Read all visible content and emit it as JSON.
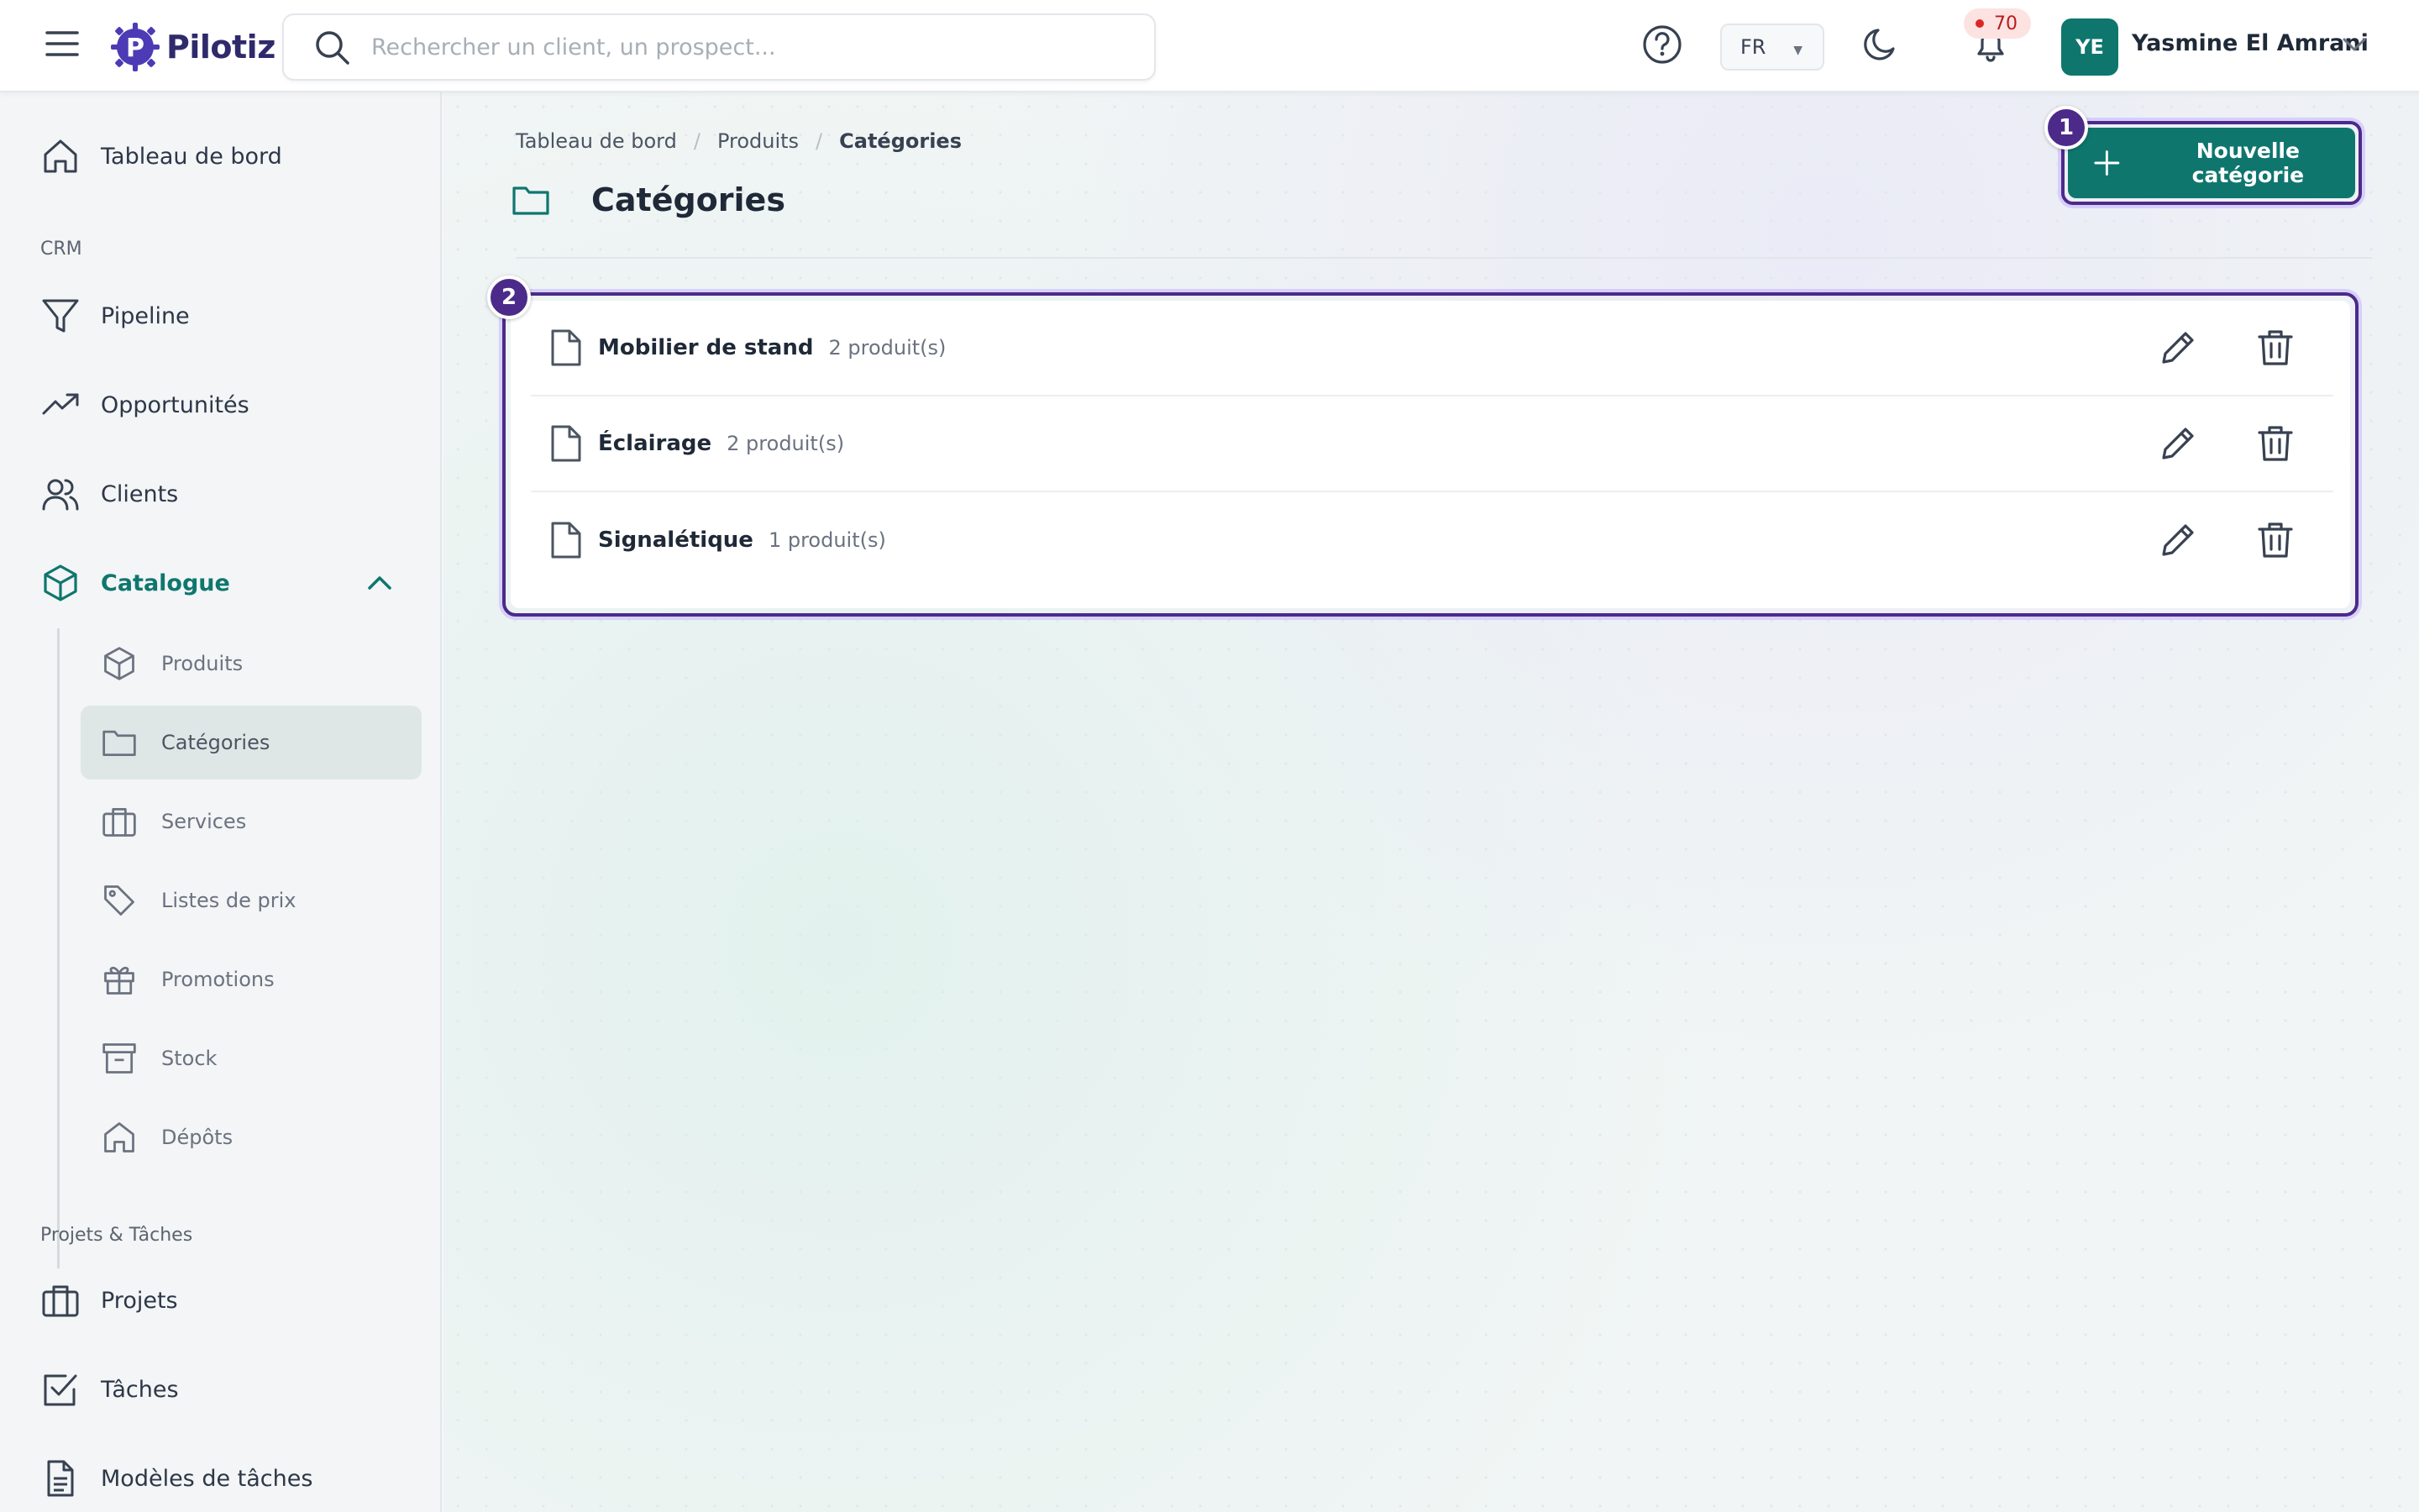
{
  "app": {
    "name": "Pilotiz"
  },
  "search": {
    "placeholder": "Rechercher un client, un prospect..."
  },
  "header": {
    "language": "FR",
    "notifications_count": "70",
    "user": {
      "initials": "YE",
      "name": "Yasmine El Amrani"
    },
    "colors": {
      "brand": "#0f766e",
      "badge_bg": "#fde2e2",
      "badge_text": "#b91c1c"
    }
  },
  "sidebar": {
    "items": [
      {
        "label": "Tableau de bord",
        "icon": "home-icon"
      }
    ],
    "sections": [
      {
        "label": "CRM",
        "items": [
          {
            "label": "Pipeline",
            "icon": "funnel-icon"
          },
          {
            "label": "Opportunités",
            "icon": "trending-up-icon"
          },
          {
            "label": "Clients",
            "icon": "users-icon"
          },
          {
            "label": "Catalogue",
            "icon": "cube-icon",
            "expanded": true,
            "active": true,
            "children": [
              {
                "label": "Produits",
                "icon": "cube-icon"
              },
              {
                "label": "Catégories",
                "icon": "folder-icon",
                "active": true
              },
              {
                "label": "Services",
                "icon": "briefcase-icon"
              },
              {
                "label": "Listes de prix",
                "icon": "tag-icon"
              },
              {
                "label": "Promotions",
                "icon": "gift-icon"
              },
              {
                "label": "Stock",
                "icon": "archive-icon"
              },
              {
                "label": "Dépôts",
                "icon": "warehouse-icon"
              }
            ]
          }
        ]
      },
      {
        "label": "Projets & Tâches",
        "items": [
          {
            "label": "Projets",
            "icon": "briefcase-icon"
          },
          {
            "label": "Tâches",
            "icon": "checkbox-icon"
          },
          {
            "label": "Modèles de tâches",
            "icon": "document-icon"
          }
        ]
      }
    ]
  },
  "breadcrumb": [
    "Tableau de bord",
    "Produits",
    "Catégories"
  ],
  "page": {
    "title": "Catégories",
    "new_button_label": "Nouvelle catégorie",
    "markers": [
      "1",
      "2"
    ]
  },
  "categories": [
    {
      "name": "Mobilier de stand",
      "count": "2 produit(s)"
    },
    {
      "name": "Éclairage",
      "count": "2 produit(s)"
    },
    {
      "name": "Signalétique",
      "count": "1 produit(s)"
    }
  ]
}
